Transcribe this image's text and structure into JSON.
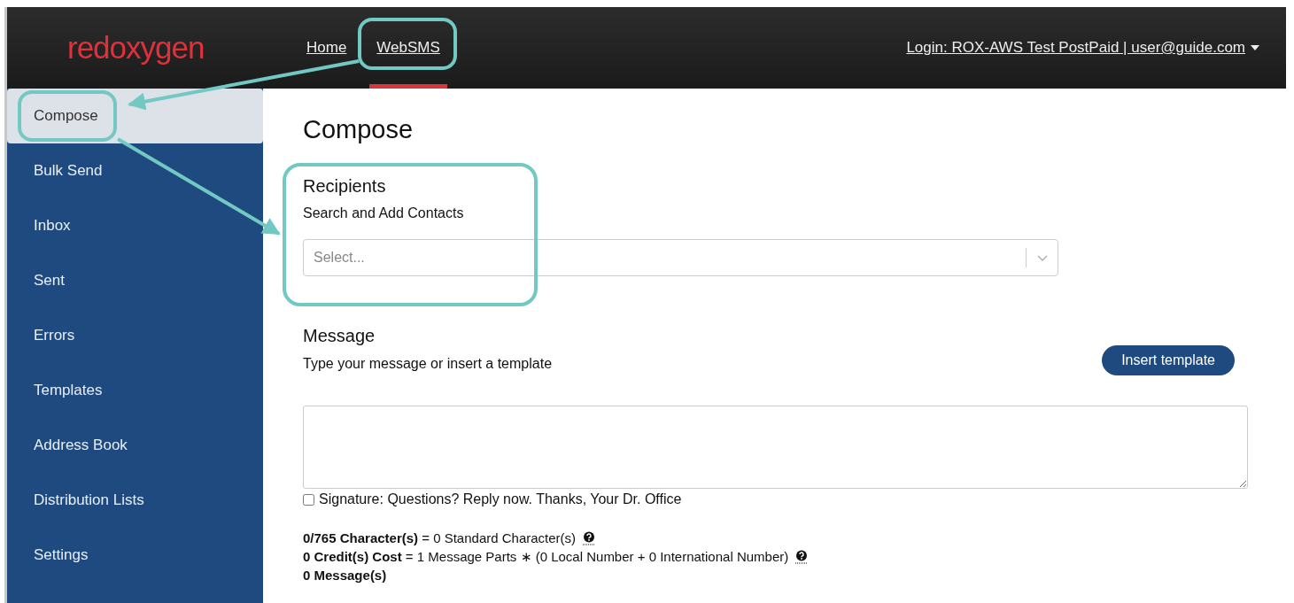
{
  "header": {
    "logo": "redoxygen",
    "nav": [
      {
        "label": "Home",
        "selected": false
      },
      {
        "label": "WebSMS",
        "selected": true
      }
    ],
    "account": "Login: ROX-AWS Test PostPaid | user@guide.com"
  },
  "sidebar": {
    "items": [
      {
        "label": "Compose",
        "selected": true
      },
      {
        "label": "Bulk Send",
        "selected": false
      },
      {
        "label": "Inbox",
        "selected": false
      },
      {
        "label": "Sent",
        "selected": false
      },
      {
        "label": "Errors",
        "selected": false
      },
      {
        "label": "Templates",
        "selected": false
      },
      {
        "label": "Address Book",
        "selected": false
      },
      {
        "label": "Distribution Lists",
        "selected": false
      },
      {
        "label": "Settings",
        "selected": false
      }
    ]
  },
  "compose": {
    "title": "Compose",
    "recipients": {
      "heading": "Recipients",
      "label": "Search and Add Contacts",
      "placeholder": "Select..."
    },
    "message": {
      "heading": "Message",
      "label": "Type your message or insert a template",
      "button": "Insert template"
    },
    "signature": {
      "label": "Signature: Questions? Reply now. Thanks, Your Dr. Office",
      "checked": false
    },
    "stats": [
      {
        "text": "**0/765 Character(s)** = 0 Standard Character(s)",
        "help": true
      },
      {
        "text": "**0 Credit(s) Cost** = 1 Message Parts ∗ (0 Local Number + 0 International Number)",
        "help": true
      },
      {
        "text": "**0 Message(s)**",
        "help": false
      }
    ]
  }
}
